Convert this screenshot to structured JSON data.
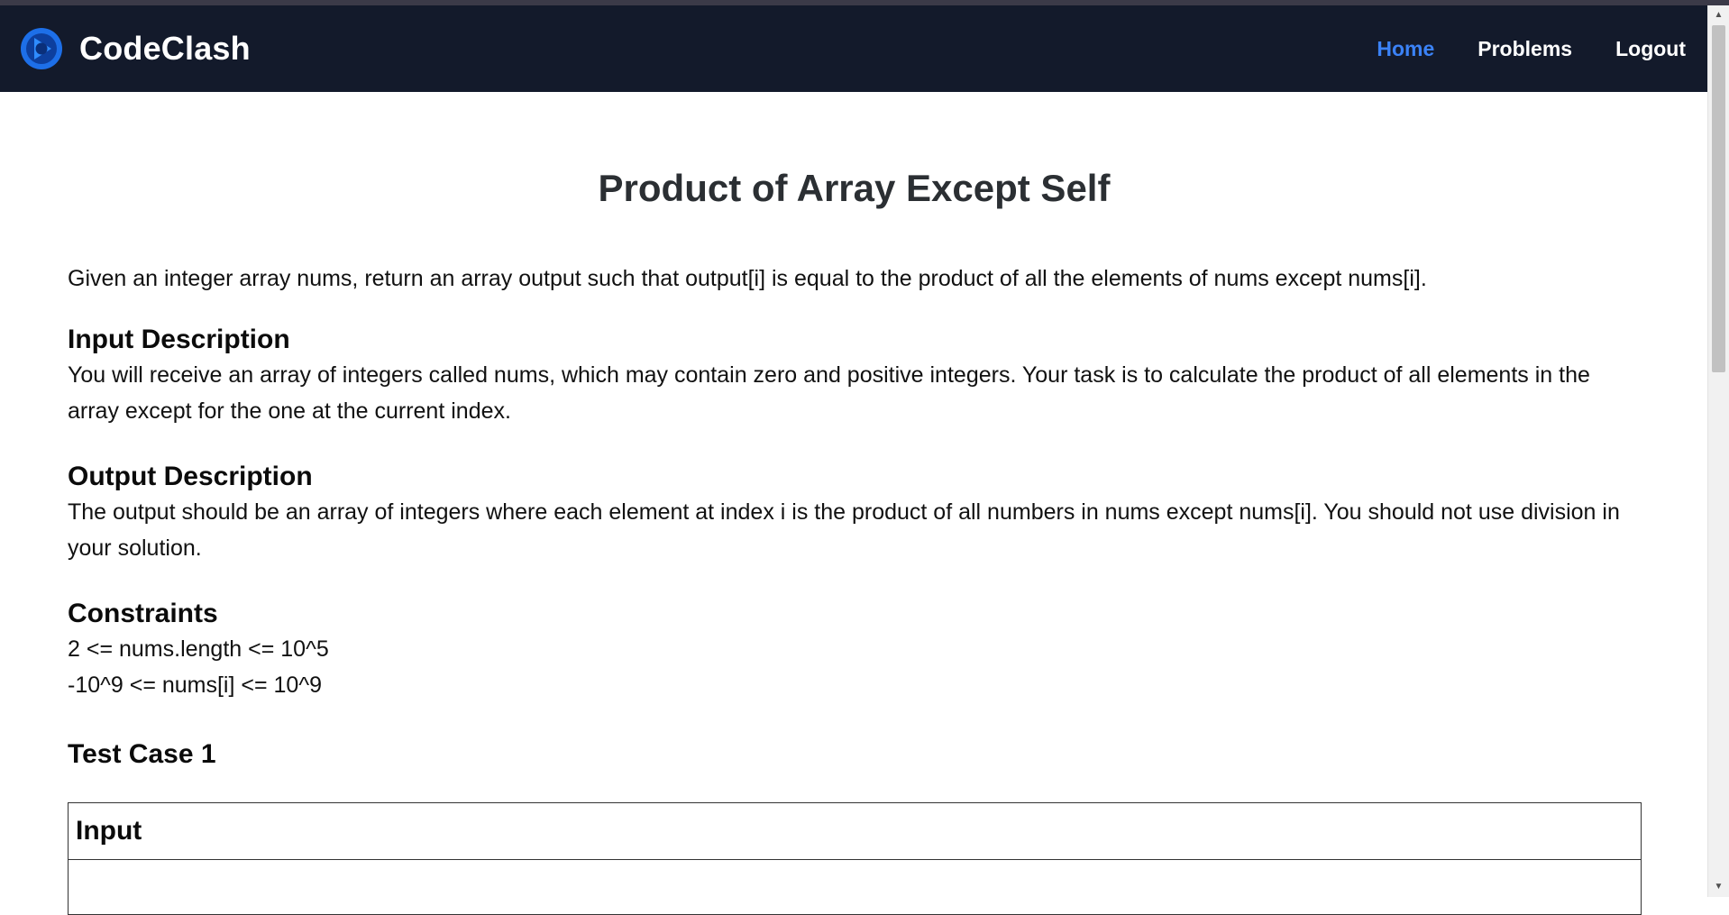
{
  "app": {
    "name": "CodeClash",
    "logo_icon": "codeclash-logo-icon"
  },
  "nav": {
    "items": [
      {
        "label": "Home",
        "active": true
      },
      {
        "label": "Problems",
        "active": false
      },
      {
        "label": "Logout",
        "active": false
      }
    ]
  },
  "problem": {
    "title": "Product of Array Except Self",
    "statement": "Given an integer array nums, return an array output such that output[i] is equal to the product of all the elements of nums except nums[i].",
    "input_description": {
      "heading": "Input Description",
      "text": "You will receive an array of integers called nums, which may contain zero and positive integers. Your task is to calculate the product of all elements in the array except for the one at the current index."
    },
    "output_description": {
      "heading": "Output Description",
      "text": "The output should be an array of integers where each element at index i is the product of all numbers in nums except nums[i]. You should not use division in your solution."
    },
    "constraints": {
      "heading": "Constraints",
      "lines": [
        "2 <= nums.length <= 10^5",
        "-10^9 <= nums[i] <= 10^9"
      ]
    },
    "test_cases": [
      {
        "heading": "Test Case 1",
        "input_label": "Input"
      }
    ]
  },
  "colors": {
    "navbar_bg": "#131a2b",
    "nav_active": "#3b82f6",
    "nav_text": "#ffffff",
    "title_text": "#2b2f33"
  }
}
